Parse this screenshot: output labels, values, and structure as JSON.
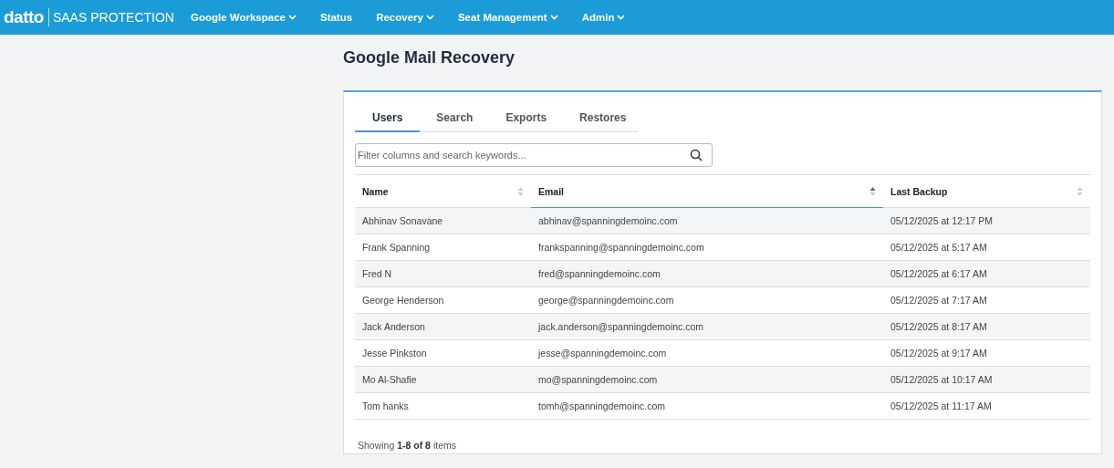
{
  "brand": {
    "logo": "datto",
    "product": "SAAS PROTECTION"
  },
  "nav": [
    {
      "label": "Google Workspace",
      "dropdown": true
    },
    {
      "label": "Status",
      "dropdown": false
    },
    {
      "label": "Recovery",
      "dropdown": true
    },
    {
      "label": "Seat Management",
      "dropdown": true
    },
    {
      "label": "Admin",
      "dropdown": true
    }
  ],
  "page_title": "Google Mail Recovery",
  "tabs": [
    {
      "label": "Users",
      "selected": true
    },
    {
      "label": "Search",
      "selected": false
    },
    {
      "label": "Exports",
      "selected": false
    },
    {
      "label": "Restores",
      "selected": false
    }
  ],
  "search": {
    "placeholder": "Filter columns and search keywords..."
  },
  "table": {
    "columns": [
      {
        "label": "Name",
        "sorted": false
      },
      {
        "label": "Email",
        "sorted": true
      },
      {
        "label": "Last Backup",
        "sorted": false
      }
    ],
    "rows": [
      [
        "Abhinav Sonavane",
        "abhinav@spanningdemoinc.com",
        "05/12/2025 at 12:17 PM"
      ],
      [
        "Frank Spanning",
        "frankspanning@spanningdemoinc.com",
        "05/12/2025 at 5:17 AM"
      ],
      [
        "Fred N",
        "fred@spanningdemoinc.com",
        "05/12/2025 at 6:17 AM"
      ],
      [
        "George Henderson",
        "george@spanningdemoinc.com",
        "05/12/2025 at 7:17 AM"
      ],
      [
        "Jack Anderson",
        "jack.anderson@spanningdemoinc.com",
        "05/12/2025 at 8:17 AM"
      ],
      [
        "Jesse Pinkston",
        "jesse@spanningdemoinc.com",
        "05/12/2025 at 9:17 AM"
      ],
      [
        "Mo Al-Shafie",
        "mo@spanningdemoinc.com",
        "05/12/2025 at 10:17 AM"
      ],
      [
        "Tom hanks",
        "tomh@spanningdemoinc.com",
        "05/12/2025 at 11:17 AM"
      ]
    ]
  },
  "footer": "Showing **1-8 of 8** items"
}
